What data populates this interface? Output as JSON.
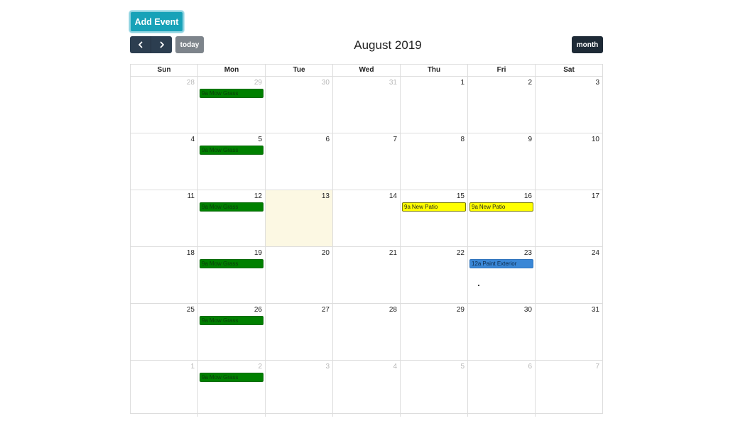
{
  "toolbar": {
    "add_event_label": "Add Event",
    "today_label": "today",
    "month_label": "month",
    "title": "August 2019",
    "prev_icon": "chevron-left-icon",
    "next_icon": "chevron-right-icon"
  },
  "colors": {
    "add_event": "#17a2b8",
    "nav": "#2c3e50",
    "today_btn": "#7d848b",
    "month_btn": "#1e2a36",
    "today_cell": "#fcf8e3",
    "mow_grass": "#008000",
    "new_patio": "#ffff00",
    "paint_exterior": "#3a87d6"
  },
  "calendar": {
    "weekdays": [
      "Sun",
      "Mon",
      "Tue",
      "Wed",
      "Thu",
      "Fri",
      "Sat"
    ],
    "today": "13",
    "weeks": [
      [
        {
          "day": "28",
          "other": true
        },
        {
          "day": "29",
          "other": true,
          "events": [
            {
              "time": "9a",
              "title": "Mow Grass",
              "type": "mow"
            }
          ]
        },
        {
          "day": "30",
          "other": true
        },
        {
          "day": "31",
          "other": true
        },
        {
          "day": "1"
        },
        {
          "day": "2"
        },
        {
          "day": "3"
        }
      ],
      [
        {
          "day": "4"
        },
        {
          "day": "5",
          "events": [
            {
              "time": "9a",
              "title": "Mow Grass",
              "type": "mow"
            }
          ]
        },
        {
          "day": "6"
        },
        {
          "day": "7"
        },
        {
          "day": "8"
        },
        {
          "day": "9"
        },
        {
          "day": "10"
        }
      ],
      [
        {
          "day": "11"
        },
        {
          "day": "12",
          "events": [
            {
              "time": "9a",
              "title": "Mow Grass",
              "type": "mow"
            }
          ]
        },
        {
          "day": "13",
          "today": true
        },
        {
          "day": "14"
        },
        {
          "day": "15",
          "events": [
            {
              "time": "9a",
              "title": "New Patio",
              "type": "patio"
            }
          ]
        },
        {
          "day": "16",
          "events": [
            {
              "time": "9a",
              "title": "New Patio",
              "type": "patio"
            }
          ]
        },
        {
          "day": "17"
        }
      ],
      [
        {
          "day": "18"
        },
        {
          "day": "19",
          "events": [
            {
              "time": "9a",
              "title": "Mow Grass",
              "type": "mow"
            }
          ]
        },
        {
          "day": "20"
        },
        {
          "day": "21"
        },
        {
          "day": "22"
        },
        {
          "day": "23",
          "events": [
            {
              "time": "12a",
              "title": "Paint Exterior",
              "type": "paint"
            }
          ]
        },
        {
          "day": "24"
        }
      ],
      [
        {
          "day": "25"
        },
        {
          "day": "26",
          "events": [
            {
              "time": "9a",
              "title": "Mow Grass",
              "type": "mow"
            }
          ]
        },
        {
          "day": "27"
        },
        {
          "day": "28"
        },
        {
          "day": "29"
        },
        {
          "day": "30"
        },
        {
          "day": "31"
        }
      ],
      [
        {
          "day": "1",
          "other": true
        },
        {
          "day": "2",
          "other": true,
          "events": [
            {
              "time": "9a",
              "title": "Mow Grass",
              "type": "mow"
            }
          ]
        },
        {
          "day": "3",
          "other": true
        },
        {
          "day": "4",
          "other": true
        },
        {
          "day": "5",
          "other": true
        },
        {
          "day": "6",
          "other": true
        },
        {
          "day": "7",
          "other": true
        }
      ]
    ]
  }
}
